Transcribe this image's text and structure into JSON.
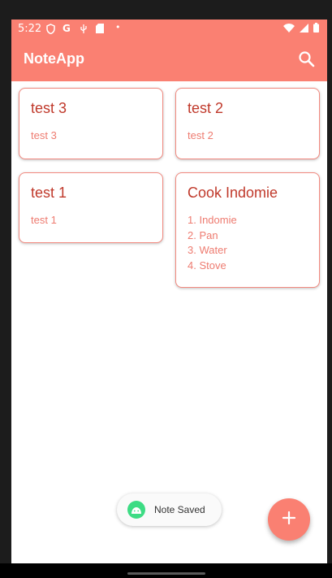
{
  "status_bar": {
    "time": "5:22",
    "icons": [
      "shield-icon",
      "google-icon",
      "usb-icon",
      "sd-card-icon",
      "dot-icon",
      "wifi-icon",
      "signal-icon",
      "battery-icon"
    ]
  },
  "app_bar": {
    "title": "NoteApp",
    "action_icon": "search-icon"
  },
  "notes": [
    {
      "title": "test 3",
      "body": "test 3"
    },
    {
      "title": "test 2",
      "body": "test 2"
    },
    {
      "title": "test 1",
      "body": "test 1"
    },
    {
      "title": "Cook Indomie",
      "body": "1. Indomie\n2. Pan\n3. Water\n4. Stove"
    }
  ],
  "toast": {
    "message": "Note Saved",
    "icon": "android-icon"
  },
  "fab": {
    "icon": "plus-icon"
  },
  "colors": {
    "primary": "#fa8072",
    "note_title": "#c0392b",
    "note_body": "#ee7b70",
    "card_border": "#f2897f"
  }
}
